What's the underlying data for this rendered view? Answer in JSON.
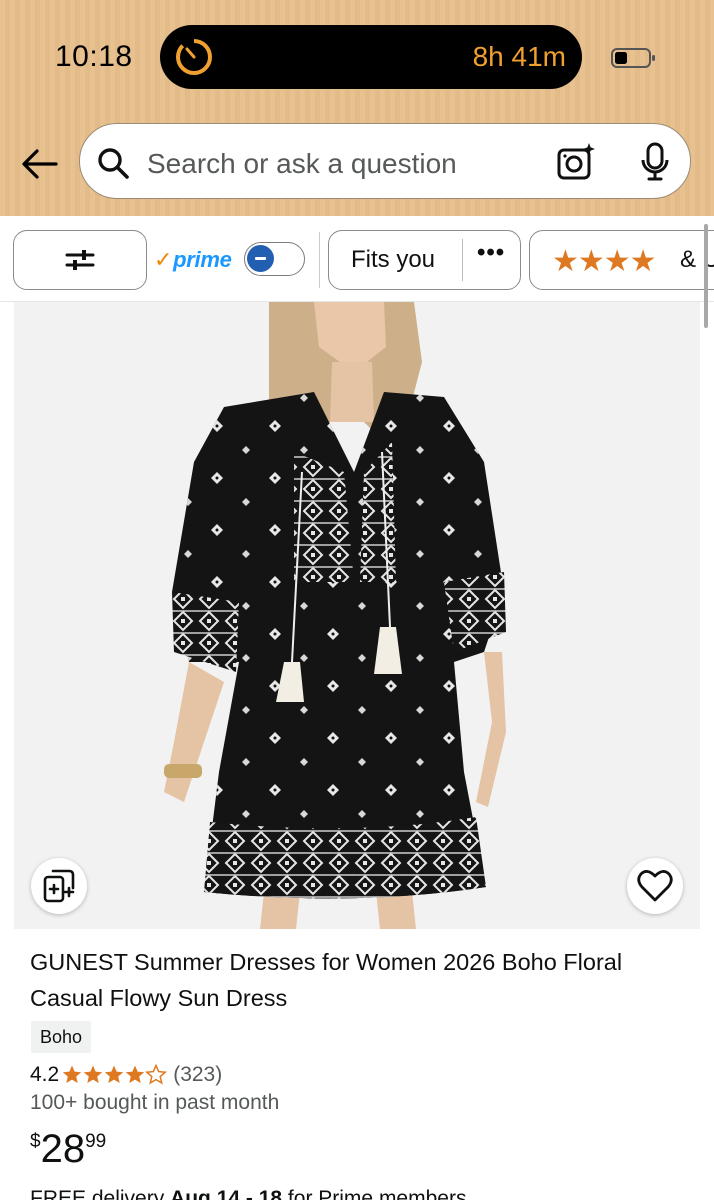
{
  "status_bar": {
    "time": "10:18",
    "timer": "8h 41m"
  },
  "search": {
    "placeholder": "Search or ask a question"
  },
  "filters": {
    "prime_label": "prime",
    "prime_toggle_on": false,
    "fits_label": "Fits you",
    "more_label": "•••",
    "stars_suffix": "& Up"
  },
  "product": {
    "title": "GUNEST Summer Dresses for Women 2026 Boho Floral Casual Flowy Sun Dress",
    "style_badge": "Boho",
    "rating": "4.2",
    "rating_stars": 4.2,
    "review_count": "(323)",
    "bought": "100+ bought in past month",
    "price_symbol": "$",
    "price_whole": "28",
    "price_fraction": "99",
    "delivery_prefix": "FREE delivery ",
    "delivery_dates": "Aug 14 - 18",
    "delivery_suffix": " for Prime members"
  },
  "colors": {
    "header": "#e7c190",
    "star": "#de7921",
    "prime_blue": "#1a98ff",
    "toggle_blue": "#235fb1",
    "timer_orange": "#f0a030"
  }
}
